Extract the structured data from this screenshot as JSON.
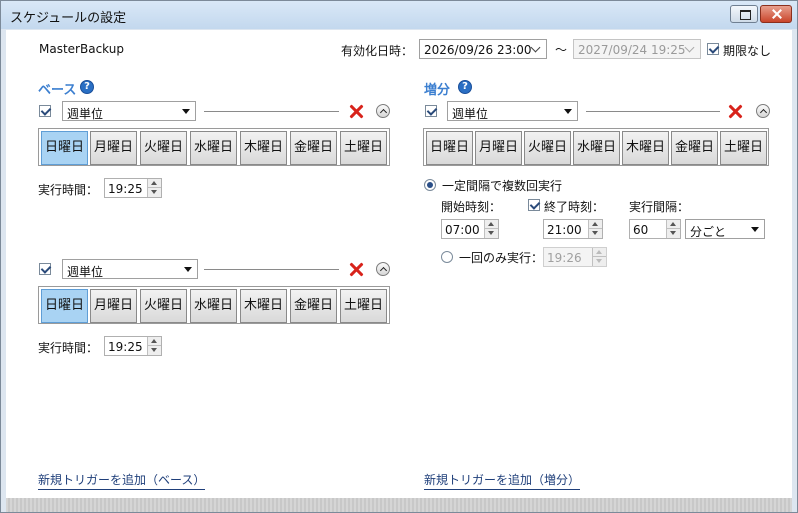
{
  "window": {
    "title": "スケジュールの設定"
  },
  "header": {
    "job_name": "MasterBackup",
    "effective_label": "有効化日時：",
    "start_datetime": "2026/09/26 23:00",
    "range_sep": "〜",
    "end_datetime": "2027/09/24 19:25",
    "no_expiry_label": "期限なし",
    "no_expiry_checked": true
  },
  "base": {
    "heading": "ベース",
    "add_trigger_link": "新規トリガーを追加（ベース）",
    "triggers": [
      {
        "enabled": true,
        "frequency": "週単位",
        "selected_day": "日曜日",
        "time_label": "実行時間：",
        "time": "19:25"
      },
      {
        "enabled": true,
        "frequency": "週単位",
        "selected_day": "日曜日",
        "time_label": "実行時間：",
        "time": "19:25"
      }
    ]
  },
  "days": [
    "日曜日",
    "月曜日",
    "火曜日",
    "水曜日",
    "木曜日",
    "金曜日",
    "土曜日"
  ],
  "incremental": {
    "heading": "増分",
    "add_trigger_link": "新規トリガーを追加（増分）",
    "enabled": true,
    "frequency": "週単位",
    "repeat_label": "一定間隔で複数回実行",
    "start_label": "開始時刻：",
    "start_time": "07:00",
    "end_label": "終了時刻：",
    "end_checked": true,
    "end_time": "21:00",
    "interval_label": "実行間隔：",
    "interval_value": "60",
    "interval_unit": "分ごと",
    "once_label": "一回のみ実行：",
    "once_time": "19:26"
  },
  "colors": {
    "accent": "#3c7fd0",
    "selected_day": "#a9d3f3",
    "delete": "#d8231b"
  }
}
